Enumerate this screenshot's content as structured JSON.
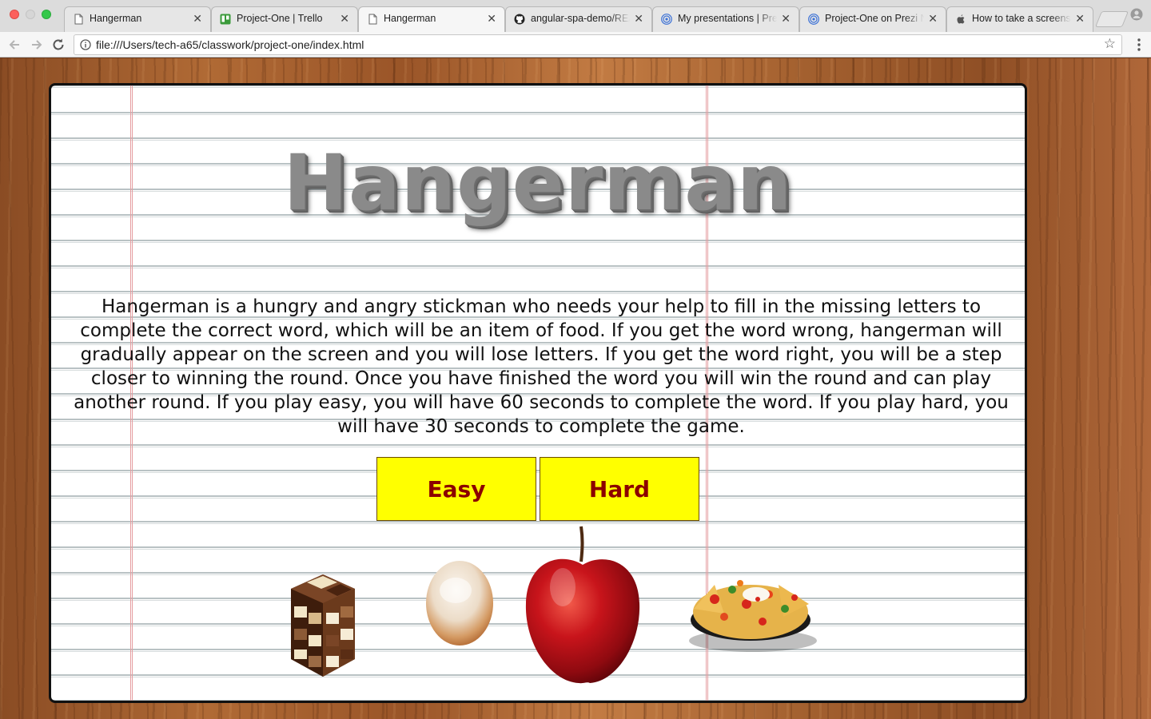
{
  "browser": {
    "tabs": [
      {
        "title": "Hangerman",
        "icon": "document-icon",
        "active": false
      },
      {
        "title": "Project-One | Trello",
        "icon": "trello-icon",
        "active": false
      },
      {
        "title": "Hangerman",
        "icon": "document-icon",
        "active": true
      },
      {
        "title": "angular-spa-demo/REA",
        "icon": "github-icon",
        "active": false
      },
      {
        "title": "My presentations | Pre",
        "icon": "prezi-icon",
        "active": false
      },
      {
        "title": "Project-One on Prezi N",
        "icon": "prezi-icon",
        "active": false
      },
      {
        "title": "How to take a screensh",
        "icon": "apple-icon",
        "active": false
      }
    ],
    "close_glyph": "✕",
    "address_bar": {
      "url": "file:///Users/tech-a65/classwork/project-one/index.html"
    }
  },
  "page": {
    "title": "Hangerman",
    "description": "Hangerman is a hungry and angry stickman who needs your help to fill in the missing letters to complete the correct word, which will be an item of food. If you get the word wrong, hangerman will gradually appear on the screen and you will lose letters. If you get the word right, you will be a step closer to winning the round. Once you have finished the word you will win the round and can play another round. If you play easy, you will have 60 seconds to complete the word. If you play hard, you will have 30 seconds to complete the game.",
    "buttons": {
      "easy": "Easy",
      "hard": "Hard"
    },
    "food_images": [
      "chocolate-image",
      "doughnut-image",
      "apple-image",
      "nachos-image"
    ]
  },
  "colors": {
    "button_bg": "#ffff00",
    "button_text": "#8b0000",
    "title": "#8a8a8a",
    "margin_line": "#e59da0",
    "paper_line": "#b9c2c4"
  }
}
